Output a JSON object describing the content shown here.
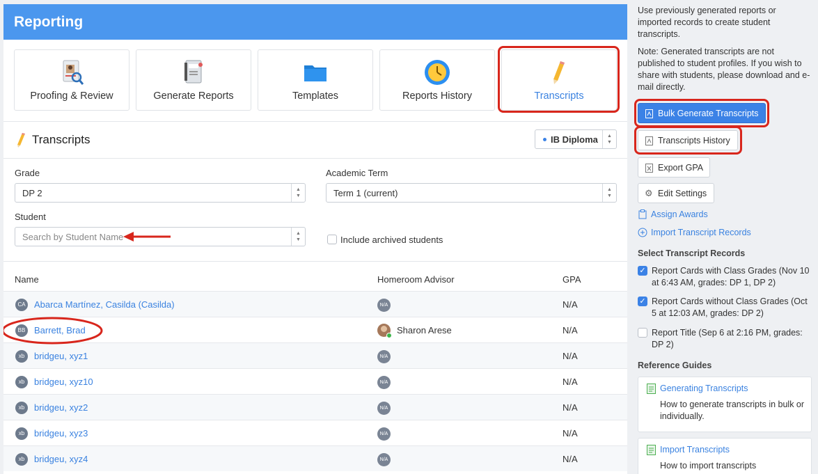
{
  "header": {
    "title": "Reporting"
  },
  "tiles": [
    {
      "label": "Proofing & Review",
      "icon": "proofing-icon"
    },
    {
      "label": "Generate Reports",
      "icon": "report-cards-icon"
    },
    {
      "label": "Templates",
      "icon": "folder-icon"
    },
    {
      "label": "Reports History",
      "icon": "clock-icon"
    },
    {
      "label": "Transcripts",
      "icon": "pencil-icon",
      "active": true
    }
  ],
  "section": {
    "title": "Transcripts",
    "program": "IB Diploma"
  },
  "filters": {
    "grade_label": "Grade",
    "grade_value": "DP 2",
    "term_label": "Academic Term",
    "term_value": "Term 1 (current)",
    "student_label": "Student",
    "student_placeholder": "Search by Student Name",
    "archived_label": "Include archived students"
  },
  "table": {
    "columns": [
      "Name",
      "Homeroom Advisor",
      "GPA"
    ],
    "rows": [
      {
        "initials": "CA",
        "name": "Abarca Martínez, Casilda (Casilda)",
        "advisor": "",
        "advisor_badge": "N/A",
        "gpa": "N/A"
      },
      {
        "initials": "BB",
        "name": "Barrett, Brad",
        "advisor": "Sharon Arese",
        "advisor_badge": "",
        "gpa": "N/A"
      },
      {
        "initials": "xb",
        "name": "bridgeu, xyz1",
        "advisor": "",
        "advisor_badge": "N/A",
        "gpa": "N/A"
      },
      {
        "initials": "xb",
        "name": "bridgeu, xyz10",
        "advisor": "",
        "advisor_badge": "N/A",
        "gpa": "N/A"
      },
      {
        "initials": "xb",
        "name": "bridgeu, xyz2",
        "advisor": "",
        "advisor_badge": "N/A",
        "gpa": "N/A"
      },
      {
        "initials": "xb",
        "name": "bridgeu, xyz3",
        "advisor": "",
        "advisor_badge": "N/A",
        "gpa": "N/A"
      },
      {
        "initials": "xb",
        "name": "bridgeu, xyz4",
        "advisor": "",
        "advisor_badge": "N/A",
        "gpa": "N/A"
      }
    ]
  },
  "sidebar": {
    "intro": "Use previously generated reports or imported records to create student transcripts.",
    "note": "Note: Generated transcripts are not published to student profiles. If you wish to share with students, please download and e-mail directly.",
    "bulk_button": "Bulk Generate Transcripts",
    "history_button": "Transcripts History",
    "export_button": "Export GPA",
    "settings_button": "Edit Settings",
    "assign_awards": "Assign Awards",
    "import_records": "Import Transcript Records",
    "select_heading": "Select Transcript Records",
    "records": [
      {
        "label": "Report Cards with Class Grades (Nov 10 at 6:43 AM, grades: DP 1, DP 2)",
        "checked": true
      },
      {
        "label": "Report Cards without Class Grades (Oct 5 at 12:03 AM, grades: DP 2)",
        "checked": true
      },
      {
        "label": "Report Title (Sep 6 at 2:16 PM, grades: DP 2)",
        "checked": false
      }
    ],
    "guides_heading": "Reference Guides",
    "guides": [
      {
        "title": "Generating Transcripts",
        "desc": "How to generate transcripts in bulk or individually."
      },
      {
        "title": "Import Transcripts",
        "desc": "How to import transcripts"
      }
    ]
  },
  "colors": {
    "accent": "#4b97ee",
    "link": "#3a82e0",
    "highlight": "#d8261c"
  }
}
